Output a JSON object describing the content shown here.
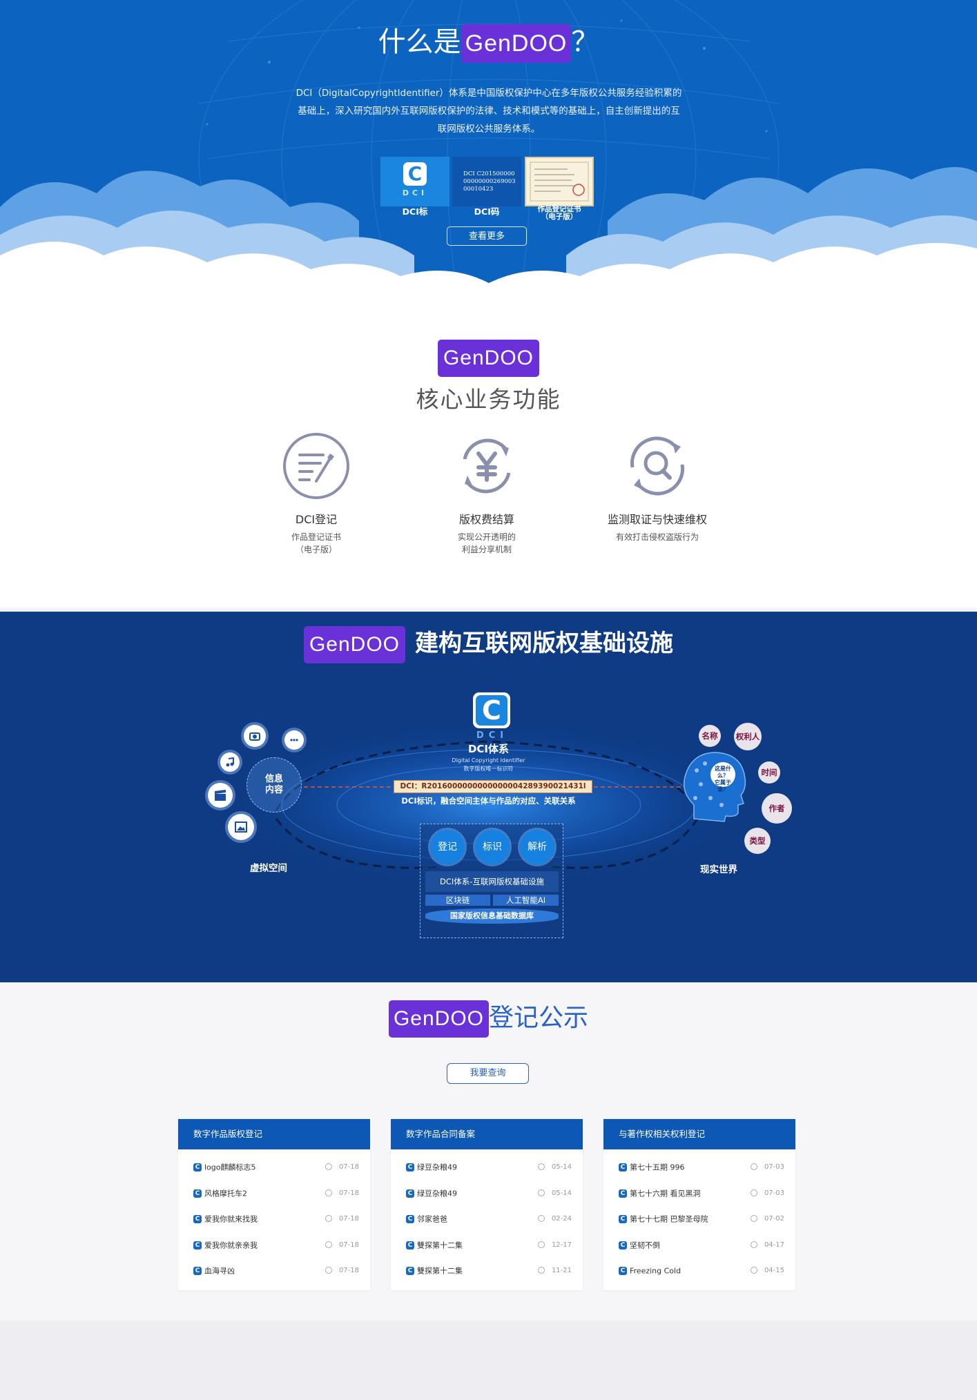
{
  "hero": {
    "title_pre": "什么是",
    "brand": "GenDOO",
    "title_post": "？",
    "description": "DCI（DigitalCopyrightIdentifier）体系是中国版权保护中心在多年版权公共服务经验积累的基础上，深入研究国内外互联网版权保护的法律、技术和模式等的基础上，自主创新提出的互联网版权公共服务体系。",
    "cards": [
      {
        "caption": "DCI标",
        "glyph": "C",
        "sub": "DCI"
      },
      {
        "caption": "DCI码",
        "code": "DCI C2015000000000000026900300010423"
      },
      {
        "caption": "作品登记证书\n（电子版）"
      }
    ],
    "more_button": "查看更多"
  },
  "core": {
    "brand": "GenDOO",
    "subtitle": "核心业务功能",
    "features": [
      {
        "icon": "edit-icon",
        "title": "DCI登记",
        "desc": "作品登记证书\n（电子版）"
      },
      {
        "icon": "yen-cycle-icon",
        "title": "版权费结算",
        "desc": "实现公开透明的\n利益分享机制"
      },
      {
        "icon": "search-cycle-icon",
        "title": "监测取证与快速维权",
        "desc": "有效打击侵权盗版行为"
      }
    ]
  },
  "infra": {
    "brand": "GenDOO",
    "title": "建构互联网版权基础设施",
    "dci_glyph": "C",
    "dci_sub": "DCI",
    "dci_system": "DCI体系",
    "dci_en": "Digital Copyright Identifier",
    "dci_cn": "数字版权唯一标识符",
    "dci_code": "DCI：R2016000000000000004289390021431l",
    "dci_desc": "DCI标识，融合空间主体与作品的对应、关联关系",
    "info_content": "信息\n内容",
    "virtual_space": "虚拟空间",
    "real_world": "现实世界",
    "head_text": "这是什么？\n它属于谁？",
    "tags": [
      "名称",
      "权利人",
      "时间",
      "作者",
      "类型"
    ],
    "actions": [
      "登记",
      "标识",
      "解析"
    ],
    "stack": {
      "top": "DCI体系-互联网版权基础设施",
      "left": "区块链",
      "right": "人工智能AI",
      "bottom": "国家版权信息基础数据库"
    }
  },
  "pub": {
    "brand": "GenDOO",
    "title": "登记公示",
    "query_button": "我要查询",
    "panels": [
      {
        "title": "数字作品版权登记",
        "rows": [
          {
            "name": "logo麒麟标志5",
            "date": "07-18"
          },
          {
            "name": "风格摩托车2",
            "date": "07-18"
          },
          {
            "name": "爱我你就来找我",
            "date": "07-18"
          },
          {
            "name": "爱我你就亲亲我",
            "date": "07-18"
          },
          {
            "name": "血海寻凶",
            "date": "07-18"
          }
        ]
      },
      {
        "title": "数字作品合同备案",
        "rows": [
          {
            "name": "绿豆杂粮49",
            "date": "05-14"
          },
          {
            "name": "绿豆杂粮49",
            "date": "05-14"
          },
          {
            "name": "邻家爸爸",
            "date": "02-24"
          },
          {
            "name": "雙探第十二集",
            "date": "12-17"
          },
          {
            "name": "雙探第十二集",
            "date": "11-21"
          }
        ]
      },
      {
        "title": "与著作权相关权利登记",
        "rows": [
          {
            "name": "第七十五期 996",
            "date": "07-03"
          },
          {
            "name": "第七十六期 看见黑洞",
            "date": "07-03"
          },
          {
            "name": "第七十七期 巴黎圣母院",
            "date": "07-02"
          },
          {
            "name": "坚韧不倒",
            "date": "04-17"
          },
          {
            "name": "Freezing Cold",
            "date": "04-15"
          }
        ]
      }
    ]
  },
  "colors": {
    "hero_blue": "#0d64c0",
    "brand_purple": "#6a31d8",
    "infra_navy": "#0e3b84",
    "panel_head": "#0d57b5"
  }
}
